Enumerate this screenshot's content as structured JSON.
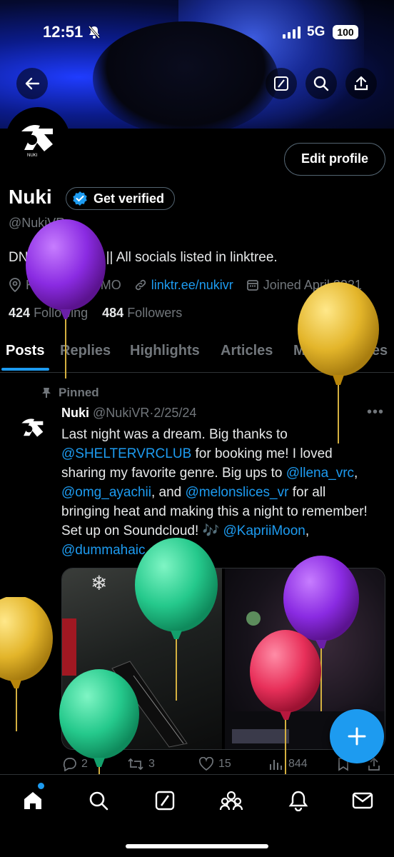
{
  "status_bar": {
    "time": "12:51",
    "network": "5G",
    "battery": "100"
  },
  "profile": {
    "name": "Nuki",
    "verify_label": "Get verified",
    "handle": "@NukiVR",
    "bio": "DNB ☠️ KCMO || All socials listed in linktree.",
    "location": "Kansas City, MO",
    "link": "linktr.ee/nukivr",
    "joined": "Joined April 2021",
    "following_count": "424",
    "following_label": "Following",
    "followers_count": "484",
    "followers_label": "Followers",
    "edit_label": "Edit profile"
  },
  "tabs": [
    {
      "label": "Posts"
    },
    {
      "label": "Replies"
    },
    {
      "label": "Highlights"
    },
    {
      "label": "Articles"
    },
    {
      "label": "Media"
    },
    {
      "label": "Likes"
    }
  ],
  "post": {
    "pinned_label": "Pinned",
    "author": "Nuki",
    "handle": "@NukiVR",
    "separator": "·",
    "date": "2/25/24",
    "text_1": "Last night was a dream.  Big thanks to",
    "mention_1": "@SHELTERVRCLUB",
    "text_2": " for booking me! I loved sharing my favorite genre. Big ups to ",
    "mention_2": "@llena_vrc",
    "text_3": ", ",
    "mention_3": "@omg_ayachii",
    "text_4": ", and ",
    "mention_4": "@melonslices_vr",
    "text_5": " for all bringing heat and making this a night to remember! Set up on Soundcloud! 🎶 ",
    "mention_5": "@KapriiMoon",
    "text_6": ", ",
    "mention_6": "@dummahaic",
    "replies": "2",
    "reposts": "3",
    "likes": "15",
    "views": "844"
  },
  "colors": {
    "accent": "#1d9bf0",
    "background": "#000000",
    "muted": "#71767b"
  }
}
